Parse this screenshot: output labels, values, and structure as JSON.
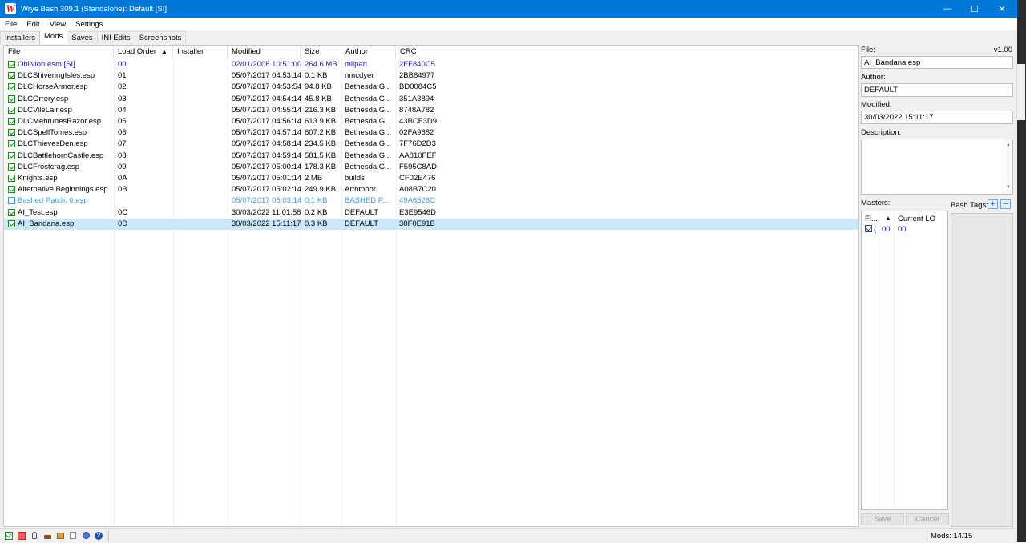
{
  "window": {
    "title": "Wrye Bash 309.1 (Standalone): Default [SI]",
    "min_glyph": "—",
    "max_glyph": "☐",
    "close_glyph": "✕"
  },
  "menu": [
    "File",
    "Edit",
    "View",
    "Settings"
  ],
  "tabs": [
    "Installers",
    "Mods",
    "Saves",
    "INI Edits",
    "Screenshots"
  ],
  "columns": {
    "file": "File",
    "load_order": "Load Order",
    "installer": "Installer",
    "modified": "Modified",
    "size": "Size",
    "author": "Author",
    "crc": "CRC",
    "sort_glyph": "▲"
  },
  "mods": [
    {
      "file": "Oblivion.esm [SI]",
      "lo": "00",
      "installer": "",
      "modified": "02/01/2006 10:51:00",
      "size": "264.6 MB",
      "author": "mlipari",
      "crc": "2FF840C5",
      "style": "master",
      "checked": true
    },
    {
      "file": "DLCShiveringIsles.esp",
      "lo": "01",
      "installer": "",
      "modified": "05/07/2017 04:53:14",
      "size": "0.1 KB",
      "author": "nmcdyer",
      "crc": "2BB84977",
      "style": "normal",
      "checked": true
    },
    {
      "file": "DLCHorseArmor.esp",
      "lo": "02",
      "installer": "",
      "modified": "05/07/2017 04:53:54",
      "size": "94.8 KB",
      "author": "Bethesda G...",
      "crc": "BD0084C5",
      "style": "normal",
      "checked": true
    },
    {
      "file": "DLCOrrery.esp",
      "lo": "03",
      "installer": "",
      "modified": "05/07/2017 04:54:14",
      "size": "45.8 KB",
      "author": "Bethesda G...",
      "crc": "351A3894",
      "style": "normal",
      "checked": true
    },
    {
      "file": "DLCVileLair.esp",
      "lo": "04",
      "installer": "",
      "modified": "05/07/2017 04:55:14",
      "size": "216.3 KB",
      "author": "Bethesda G...",
      "crc": "8748A782",
      "style": "normal",
      "checked": true
    },
    {
      "file": "DLCMehrunesRazor.esp",
      "lo": "05",
      "installer": "",
      "modified": "05/07/2017 04:56:14",
      "size": "613.9 KB",
      "author": "Bethesda G...",
      "crc": "43BCF3D9",
      "style": "normal",
      "checked": true
    },
    {
      "file": "DLCSpellTomes.esp",
      "lo": "06",
      "installer": "",
      "modified": "05/07/2017 04:57:14",
      "size": "607.2 KB",
      "author": "Bethesda G...",
      "crc": "02FA9682",
      "style": "normal",
      "checked": true
    },
    {
      "file": "DLCThievesDen.esp",
      "lo": "07",
      "installer": "",
      "modified": "05/07/2017 04:58:14",
      "size": "234.5 KB",
      "author": "Bethesda G...",
      "crc": "7F76D2D3",
      "style": "normal",
      "checked": true
    },
    {
      "file": "DLCBattlehornCastle.esp",
      "lo": "08",
      "installer": "",
      "modified": "05/07/2017 04:59:14",
      "size": "581.5 KB",
      "author": "Bethesda G...",
      "crc": "AA810FEF",
      "style": "normal",
      "checked": true
    },
    {
      "file": "DLCFrostcrag.esp",
      "lo": "09",
      "installer": "",
      "modified": "05/07/2017 05:00:14",
      "size": "178.3 KB",
      "author": "Bethesda G...",
      "crc": "F595C8AD",
      "style": "normal",
      "checked": true
    },
    {
      "file": "Knights.esp",
      "lo": "0A",
      "installer": "",
      "modified": "05/07/2017 05:01:14",
      "size": "2 MB",
      "author": "builds",
      "crc": "CF02E476",
      "style": "normal",
      "checked": true
    },
    {
      "file": "Alternative Beginnings.esp",
      "lo": "0B",
      "installer": "",
      "modified": "05/07/2017 05:02:14",
      "size": "249.9 KB",
      "author": "Arthmoor",
      "crc": "A08B7C20",
      "style": "normal",
      "checked": true
    },
    {
      "file": "Bashed Patch, 0.esp",
      "lo": "",
      "installer": "",
      "modified": "05/07/2017 05:03:14",
      "size": "0.1 KB",
      "author": "BASHED P...",
      "crc": "49A6528C",
      "style": "bashed",
      "checked": false
    },
    {
      "file": "AI_Test.esp",
      "lo": "0C",
      "installer": "",
      "modified": "30/03/2022 11:01:58",
      "size": "0.2 KB",
      "author": "DEFAULT",
      "crc": "E3E9546D",
      "style": "normal",
      "checked": true
    },
    {
      "file": "AI_Bandana.esp",
      "lo": "0D",
      "installer": "",
      "modified": "30/03/2022 15:11:17",
      "size": "0.3 KB",
      "author": "DEFAULT",
      "crc": "38F0E91B",
      "style": "normal",
      "checked": true,
      "selected": true
    }
  ],
  "details": {
    "file_label": "File:",
    "version": "v1.00",
    "file_value": "AI_Bandana.esp",
    "author_label": "Author:",
    "author_value": "DEFAULT",
    "modified_label": "Modified:",
    "modified_value": "30/03/2022 15:11:17",
    "description_label": "Description:",
    "masters_label": "Masters:",
    "bash_tags_label": "Bash Tags:",
    "masters_col_file": "Fi...",
    "masters_col_sort": "▲",
    "masters_col_lo": "Current LO",
    "master_row": {
      "name_clip": "(",
      "lo": "00",
      "current": "00"
    },
    "save_label": "Save",
    "cancel_label": "Cancel",
    "add_tag_glyph": "+",
    "remove_tag_glyph": "−"
  },
  "status": {
    "mods_count": "Mods: 14/15",
    "icon_glyphs": {
      "info": "?"
    }
  },
  "colors": {
    "master_text": "#1a1ab0",
    "bashed_text": "#3aa0d8",
    "selected_row": "#cce8ff",
    "titlebar": "#0078d7"
  }
}
